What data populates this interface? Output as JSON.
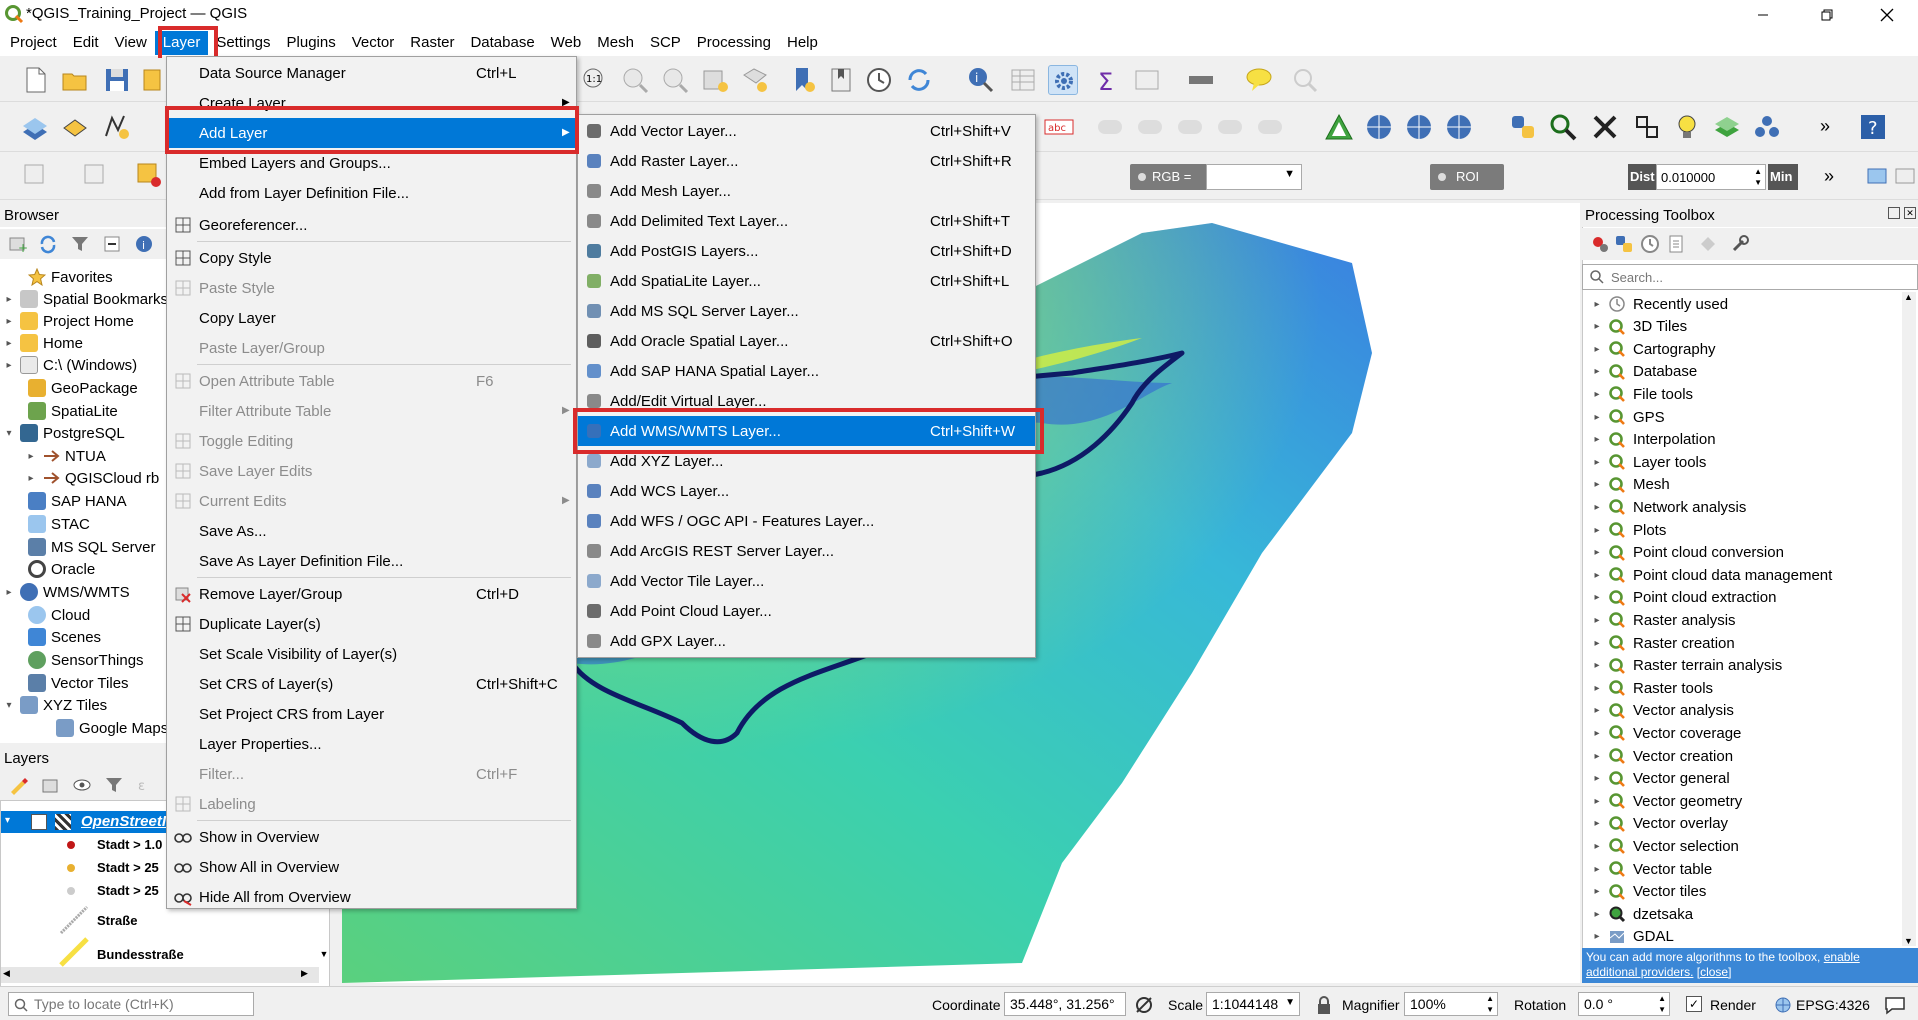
{
  "window": {
    "title": "*QGIS_Training_Project — QGIS"
  },
  "menubar": [
    "Project",
    "Edit",
    "View",
    "Layer",
    "Settings",
    "Plugins",
    "Vector",
    "Raster",
    "Database",
    "Web",
    "Mesh",
    "SCP",
    "Processing",
    "Help"
  ],
  "layer_menu": {
    "items": [
      {
        "label": "Data Source Manager",
        "shortcut": "Ctrl+L",
        "disabled": false,
        "submenu": false
      },
      {
        "label": "Create Layer",
        "shortcut": "",
        "disabled": false,
        "submenu": true
      },
      {
        "label": "Add Layer",
        "shortcut": "",
        "disabled": false,
        "submenu": true,
        "highlighted": true
      },
      {
        "label": "Embed Layers and Groups...",
        "shortcut": "",
        "disabled": false,
        "submenu": false
      },
      {
        "label": "Add from Layer Definition File...",
        "shortcut": "",
        "disabled": false,
        "submenu": false
      },
      {
        "label": "Georeferencer...",
        "shortcut": "",
        "disabled": false,
        "submenu": false
      },
      {
        "label": "Copy Style",
        "shortcut": "",
        "disabled": false,
        "submenu": false
      },
      {
        "label": "Paste Style",
        "shortcut": "",
        "disabled": true,
        "submenu": false
      },
      {
        "label": "Copy Layer",
        "shortcut": "",
        "disabled": false,
        "submenu": false
      },
      {
        "label": "Paste Layer/Group",
        "shortcut": "",
        "disabled": true,
        "submenu": false
      },
      {
        "label": "Open Attribute Table",
        "shortcut": "F6",
        "disabled": true,
        "submenu": false
      },
      {
        "label": "Filter Attribute Table",
        "shortcut": "",
        "disabled": true,
        "submenu": true
      },
      {
        "label": "Toggle Editing",
        "shortcut": "",
        "disabled": true,
        "submenu": false
      },
      {
        "label": "Save Layer Edits",
        "shortcut": "",
        "disabled": true,
        "submenu": false
      },
      {
        "label": "Current Edits",
        "shortcut": "",
        "disabled": true,
        "submenu": true
      },
      {
        "label": "Save As...",
        "shortcut": "",
        "disabled": false,
        "submenu": false
      },
      {
        "label": "Save As Layer Definition File...",
        "shortcut": "",
        "disabled": false,
        "submenu": false
      },
      {
        "label": "Remove Layer/Group",
        "shortcut": "Ctrl+D",
        "disabled": false,
        "submenu": false
      },
      {
        "label": "Duplicate Layer(s)",
        "shortcut": "",
        "disabled": false,
        "submenu": false
      },
      {
        "label": "Set Scale Visibility of Layer(s)",
        "shortcut": "",
        "disabled": false,
        "submenu": false
      },
      {
        "label": "Set CRS of Layer(s)",
        "shortcut": "Ctrl+Shift+C",
        "disabled": false,
        "submenu": false
      },
      {
        "label": "Set Project CRS from Layer",
        "shortcut": "",
        "disabled": false,
        "submenu": false
      },
      {
        "label": "Layer Properties...",
        "shortcut": "",
        "disabled": false,
        "submenu": false
      },
      {
        "label": "Filter...",
        "shortcut": "Ctrl+F",
        "disabled": true,
        "submenu": false
      },
      {
        "label": "Labeling",
        "shortcut": "",
        "disabled": true,
        "submenu": false
      },
      {
        "label": "Show in Overview",
        "shortcut": "",
        "disabled": false,
        "submenu": false
      },
      {
        "label": "Show All in Overview",
        "shortcut": "",
        "disabled": false,
        "submenu": false
      },
      {
        "label": "Hide All from Overview",
        "shortcut": "",
        "disabled": false,
        "submenu": false
      }
    ]
  },
  "add_layer_submenu": {
    "items": [
      {
        "label": "Add Vector Layer...",
        "shortcut": "Ctrl+Shift+V"
      },
      {
        "label": "Add Raster Layer...",
        "shortcut": "Ctrl+Shift+R"
      },
      {
        "label": "Add Mesh Layer...",
        "shortcut": ""
      },
      {
        "label": "Add Delimited Text Layer...",
        "shortcut": "Ctrl+Shift+T"
      },
      {
        "label": "Add PostGIS Layers...",
        "shortcut": "Ctrl+Shift+D"
      },
      {
        "label": "Add SpatiaLite Layer...",
        "shortcut": "Ctrl+Shift+L"
      },
      {
        "label": "Add MS SQL Server Layer...",
        "shortcut": ""
      },
      {
        "label": "Add Oracle Spatial Layer...",
        "shortcut": "Ctrl+Shift+O"
      },
      {
        "label": "Add SAP HANA Spatial Layer...",
        "shortcut": ""
      },
      {
        "label": "Add/Edit Virtual Layer...",
        "shortcut": ""
      },
      {
        "label": "Add WMS/WMTS Layer...",
        "shortcut": "Ctrl+Shift+W",
        "highlighted": true
      },
      {
        "label": "Add XYZ Layer...",
        "shortcut": ""
      },
      {
        "label": "Add WCS Layer...",
        "shortcut": ""
      },
      {
        "label": "Add WFS / OGC API - Features Layer...",
        "shortcut": ""
      },
      {
        "label": "Add ArcGIS REST Server Layer...",
        "shortcut": ""
      },
      {
        "label": "Add Vector Tile Layer...",
        "shortcut": ""
      },
      {
        "label": "Add Point Cloud Layer...",
        "shortcut": ""
      },
      {
        "label": "Add GPX Layer...",
        "shortcut": ""
      }
    ]
  },
  "browser": {
    "title": "Browser",
    "items": [
      {
        "label": "Favorites",
        "arrow": ""
      },
      {
        "label": "Spatial Bookmarks",
        "arrow": "▸"
      },
      {
        "label": "Project Home",
        "arrow": "▸"
      },
      {
        "label": "Home",
        "arrow": "▸"
      },
      {
        "label": "C:\\ (Windows)",
        "arrow": "▸"
      },
      {
        "label": "GeoPackage",
        "arrow": ""
      },
      {
        "label": "SpatiaLite",
        "arrow": ""
      },
      {
        "label": "PostgreSQL",
        "arrow": "▾"
      },
      {
        "label": "NTUA",
        "arrow": "▸"
      },
      {
        "label": "QGISCloud rb",
        "arrow": "▸"
      },
      {
        "label": "SAP HANA",
        "arrow": ""
      },
      {
        "label": "STAC",
        "arrow": ""
      },
      {
        "label": "MS SQL Server",
        "arrow": ""
      },
      {
        "label": "Oracle",
        "arrow": ""
      },
      {
        "label": "WMS/WMTS",
        "arrow": "▸"
      },
      {
        "label": "Cloud",
        "arrow": ""
      },
      {
        "label": "Scenes",
        "arrow": ""
      },
      {
        "label": "SensorThings",
        "arrow": ""
      },
      {
        "label": "Vector Tiles",
        "arrow": ""
      },
      {
        "label": "XYZ Tiles",
        "arrow": "▾"
      },
      {
        "label": "Google Maps",
        "arrow": ""
      }
    ]
  },
  "layers": {
    "title": "Layers",
    "items": [
      {
        "label": "OpenStreetI"
      },
      {
        "label": "Stadt > 1.0"
      },
      {
        "label": "Stadt > 25"
      },
      {
        "label": "Stadt > 25"
      },
      {
        "label": "Straße"
      },
      {
        "label": "Bundesstraße"
      }
    ]
  },
  "toolbar": {
    "rgb_label": "RGB =",
    "roi_label": "ROI",
    "dist_label": "Dist",
    "dist_value": "0.010000",
    "min_label": "Min"
  },
  "processing": {
    "title": "Processing Toolbox",
    "search_placeholder": "Search...",
    "items": [
      "Recently used",
      "3D Tiles",
      "Cartography",
      "Database",
      "File tools",
      "GPS",
      "Interpolation",
      "Layer tools",
      "Mesh",
      "Network analysis",
      "Plots",
      "Point cloud conversion",
      "Point cloud data management",
      "Point cloud extraction",
      "Raster analysis",
      "Raster creation",
      "Raster terrain analysis",
      "Raster tools",
      "Vector analysis",
      "Vector coverage",
      "Vector creation",
      "Vector general",
      "Vector geometry",
      "Vector overlay",
      "Vector selection",
      "Vector table",
      "Vector tiles",
      "dzetsaka",
      "GDAL"
    ],
    "info_text": "You can add more algorithms to the toolbox,",
    "info_link1": "enable additional providers.",
    "info_link2": "[close]"
  },
  "statusbar": {
    "locate_placeholder": "Type to locate (Ctrl+K)",
    "coordinate_label": "Coordinate",
    "coordinate_value": "35.448°, 31.256°",
    "scale_label": "Scale",
    "scale_value": "1:1044148",
    "magnifier_label": "Magnifier",
    "magnifier_value": "100%",
    "rotation_label": "Rotation",
    "rotation_value": "0.0 °",
    "render_label": "Render",
    "crs_label": "EPSG:4326"
  }
}
